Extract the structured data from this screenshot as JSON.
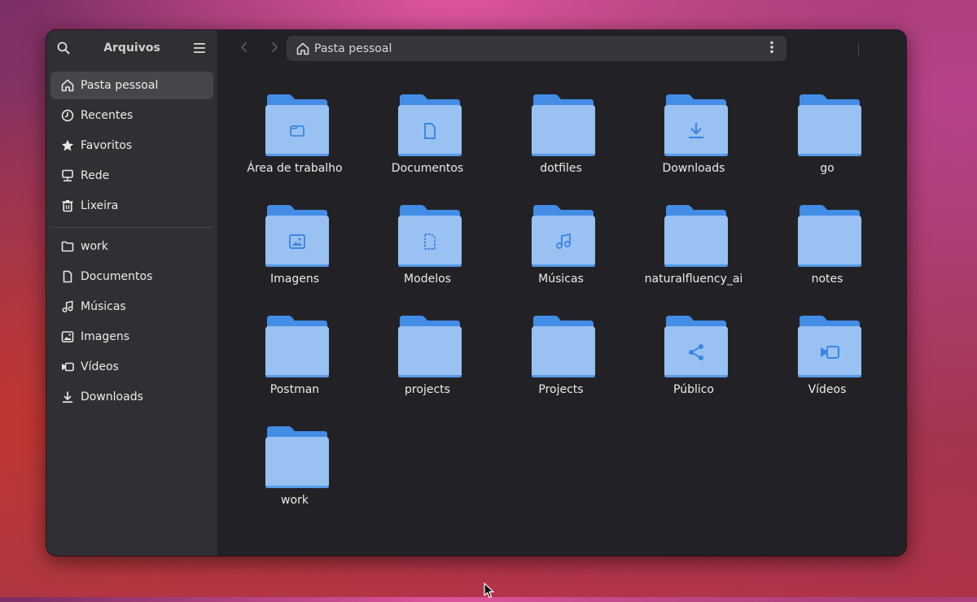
{
  "window": {
    "app_title": "Arquivos",
    "location": "Pasta pessoal"
  },
  "toolbar": {
    "search_icon": "search-icon",
    "main_menu_icon": "hamburger-menu-icon",
    "back_icon": "chevron-left-icon",
    "forward_icon": "chevron-right-icon",
    "location_menu_icon": "vertical-dots-icon",
    "search_in_folder_icon": "folder-search-icon",
    "view_mode_icon": "list-view-icon",
    "view_options_icon": "dropdown-arrow-icon",
    "close_icon": "close-icon"
  },
  "sidebar": {
    "places": [
      {
        "label": "Pasta pessoal",
        "icon": "home-icon",
        "selected": true
      },
      {
        "label": "Recentes",
        "icon": "clock-icon",
        "selected": false
      },
      {
        "label": "Favoritos",
        "icon": "star-icon",
        "selected": false
      },
      {
        "label": "Rede",
        "icon": "network-icon",
        "selected": false
      },
      {
        "label": "Lixeira",
        "icon": "trash-icon",
        "selected": false
      }
    ],
    "bookmarks": [
      {
        "label": "work",
        "icon": "folder-icon"
      },
      {
        "label": "Documentos",
        "icon": "document-icon"
      },
      {
        "label": "Músicas",
        "icon": "music-icon"
      },
      {
        "label": "Imagens",
        "icon": "image-icon"
      },
      {
        "label": "Vídeos",
        "icon": "video-icon"
      },
      {
        "label": "Downloads",
        "icon": "download-icon"
      }
    ]
  },
  "folders": [
    {
      "name": "Área de trabalho",
      "emblem": "desktop"
    },
    {
      "name": "Documentos",
      "emblem": "document"
    },
    {
      "name": "dotfiles",
      "emblem": "none"
    },
    {
      "name": "Downloads",
      "emblem": "download"
    },
    {
      "name": "go",
      "emblem": "none"
    },
    {
      "name": "Imagens",
      "emblem": "image"
    },
    {
      "name": "Modelos",
      "emblem": "template"
    },
    {
      "name": "Músicas",
      "emblem": "music"
    },
    {
      "name": "naturalfluency_ai",
      "emblem": "none"
    },
    {
      "name": "notes",
      "emblem": "none"
    },
    {
      "name": "Postman",
      "emblem": "none"
    },
    {
      "name": "projects",
      "emblem": "none"
    },
    {
      "name": "Projects",
      "emblem": "none"
    },
    {
      "name": "Público",
      "emblem": "share"
    },
    {
      "name": "Vídeos",
      "emblem": "video"
    },
    {
      "name": "work",
      "emblem": "none"
    }
  ],
  "colors": {
    "folder_back": "#438de6",
    "folder_front": "#99c1f1",
    "emblem": "#3d86e1",
    "sidebar_bg": "#303034",
    "content_bg": "#222226"
  }
}
